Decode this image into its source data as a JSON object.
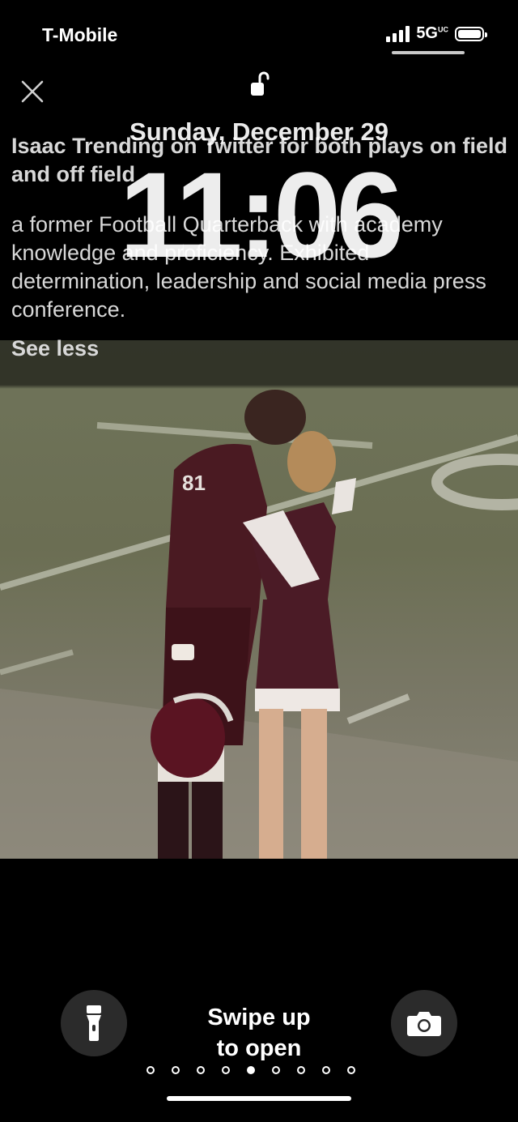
{
  "status_bar": {
    "carrier": "T-Mobile",
    "network": "5G",
    "network_badge": "UC"
  },
  "lock_screen": {
    "date": "Sunday, December 29",
    "time": "11:06"
  },
  "story": {
    "title": "Isaac Trending on Twitter for both plays on field and off field",
    "body": "a former Football Quarterback with academy knowledge and proficiency. Exhibited determination, leadership and social media press conference.",
    "toggle_label": "See less"
  },
  "photo": {
    "jersey_number": "81"
  },
  "controls": {
    "swipe_line1": "Swipe up",
    "swipe_line2": "to open",
    "left_button_icon": "flashlight-icon",
    "right_button_icon": "camera-icon",
    "page_count": 9,
    "active_page": 5
  }
}
